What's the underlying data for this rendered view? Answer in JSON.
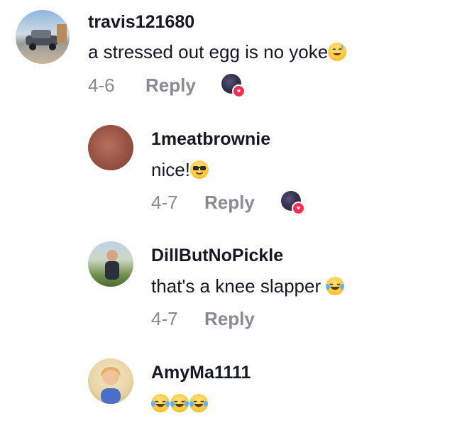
{
  "comments": [
    {
      "username": "travis121680",
      "text": "a stressed out egg is no yoke",
      "emoji": "sweat-smile",
      "date": "4-6",
      "reply_label": "Reply",
      "creator_liked": true
    },
    {
      "username": "1meatbrownie",
      "text": "nice!",
      "emoji": "sunglasses",
      "date": "4-7",
      "reply_label": "Reply",
      "creator_liked": true
    },
    {
      "username": "DillButNoPickle",
      "text": "that's a knee slapper",
      "emoji": "tears-of-joy",
      "date": "4-7",
      "reply_label": "Reply",
      "creator_liked": false
    },
    {
      "username": "AmyMa1111",
      "text": "",
      "emoji": "tears-of-joy x3",
      "date": "",
      "reply_label": "",
      "creator_liked": false
    }
  ],
  "colors": {
    "username": "#161823",
    "meta": "#8a8b91",
    "like_heart": "#fe2c55"
  }
}
